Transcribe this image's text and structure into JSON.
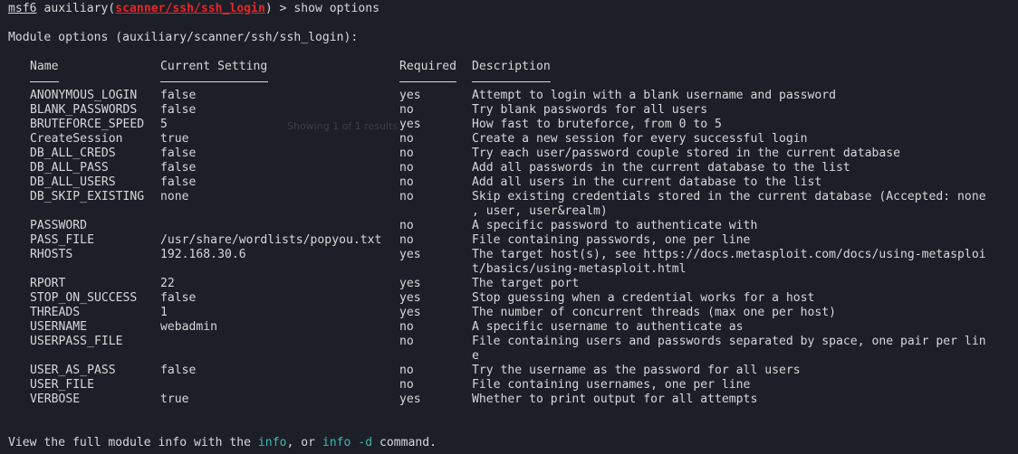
{
  "prompt": {
    "prefix": "msf6",
    "module_word": "auxiliary",
    "paren_open": "(",
    "module_path": "scanner/ssh/ssh_login",
    "paren_close": ")",
    "arrow": " > ",
    "command": "show options"
  },
  "module_title": "Module options (auxiliary/scanner/ssh/ssh_login):",
  "headers": {
    "name": "Name",
    "setting": "Current Setting",
    "required": "Required",
    "description": "Description"
  },
  "options": [
    {
      "name": "ANONYMOUS_LOGIN",
      "setting": "false",
      "required": "yes",
      "desc": [
        "Attempt to login with a blank username and password"
      ]
    },
    {
      "name": "BLANK_PASSWORDS",
      "setting": "false",
      "required": "no",
      "desc": [
        "Try blank passwords for all users"
      ]
    },
    {
      "name": "BRUTEFORCE_SPEED",
      "setting": "5",
      "required": "yes",
      "desc": [
        "How fast to bruteforce, from 0 to 5"
      ]
    },
    {
      "name": "CreateSession",
      "setting": "true",
      "required": "no",
      "desc": [
        "Create a new session for every successful login"
      ]
    },
    {
      "name": "DB_ALL_CREDS",
      "setting": "false",
      "required": "no",
      "desc": [
        "Try each user/password couple stored in the current database"
      ]
    },
    {
      "name": "DB_ALL_PASS",
      "setting": "false",
      "required": "no",
      "desc": [
        "Add all passwords in the current database to the list"
      ]
    },
    {
      "name": "DB_ALL_USERS",
      "setting": "false",
      "required": "no",
      "desc": [
        "Add all users in the current database to the list"
      ]
    },
    {
      "name": "DB_SKIP_EXISTING",
      "setting": "none",
      "required": "no",
      "desc": [
        "Skip existing credentials stored in the current database (Accepted: none",
        ", user, user&realm)"
      ]
    },
    {
      "name": "PASSWORD",
      "setting": "",
      "required": "no",
      "desc": [
        "A specific password to authenticate with"
      ]
    },
    {
      "name": "PASS_FILE",
      "setting": "/usr/share/wordlists/popyou.txt",
      "required": "no",
      "desc": [
        "File containing passwords, one per line"
      ]
    },
    {
      "name": "RHOSTS",
      "setting": "192.168.30.6",
      "required": "yes",
      "desc": [
        "The target host(s), see https://docs.metasploit.com/docs/using-metasploi",
        "t/basics/using-metasploit.html"
      ]
    },
    {
      "name": "RPORT",
      "setting": "22",
      "required": "yes",
      "desc": [
        "The target port"
      ]
    },
    {
      "name": "STOP_ON_SUCCESS",
      "setting": "false",
      "required": "yes",
      "desc": [
        "Stop guessing when a credential works for a host"
      ]
    },
    {
      "name": "THREADS",
      "setting": "1",
      "required": "yes",
      "desc": [
        "The number of concurrent threads (max one per host)"
      ]
    },
    {
      "name": "USERNAME",
      "setting": "webadmin",
      "required": "no",
      "desc": [
        "A specific username to authenticate as"
      ]
    },
    {
      "name": "USERPASS_FILE",
      "setting": "",
      "required": "no",
      "desc": [
        "File containing users and passwords separated by space, one pair per lin",
        "e"
      ]
    },
    {
      "name": "USER_AS_PASS",
      "setting": "false",
      "required": "no",
      "desc": [
        "Try the username as the password for all users"
      ]
    },
    {
      "name": "USER_FILE",
      "setting": "",
      "required": "no",
      "desc": [
        "File containing usernames, one per line"
      ]
    },
    {
      "name": "VERBOSE",
      "setting": "true",
      "required": "yes",
      "desc": [
        "Whether to print output for all attempts"
      ]
    }
  ],
  "footer": {
    "before": "View the full module info with the ",
    "info": "info",
    "middle": ", or ",
    "info_d": "info -d",
    "after": " command."
  },
  "ghost_text": "Showing 1 of 1 results",
  "colors": {
    "background": "#1c1f27",
    "text": "#d6d7da",
    "module_path": "#e3262a",
    "command_link": "#3fb7b0"
  }
}
